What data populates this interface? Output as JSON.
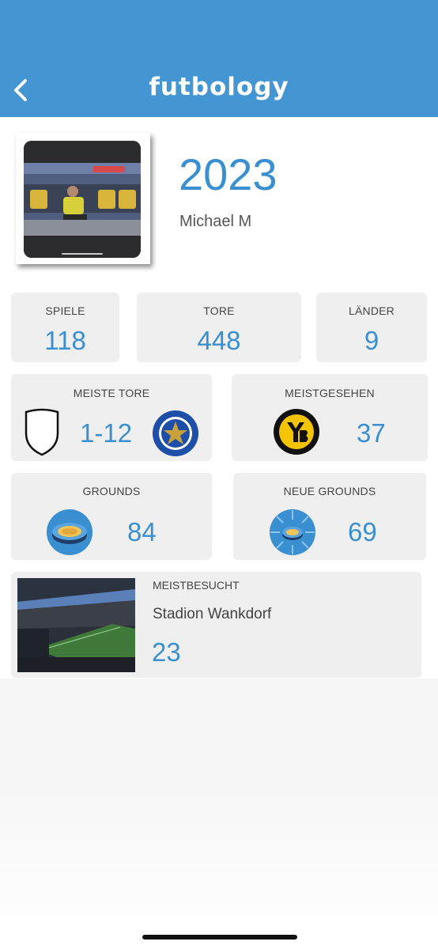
{
  "header": {
    "app_name": "futbology",
    "back_icon": "chevron-left-icon",
    "color": "#4496d2"
  },
  "profile": {
    "year": "2023",
    "name": "Michael M"
  },
  "stats": {
    "spiele": {
      "label": "SPIELE",
      "value": "118"
    },
    "tore": {
      "label": "TORE",
      "value": "448"
    },
    "laender": {
      "label": "LÄNDER",
      "value": "9"
    }
  },
  "meiste_tore": {
    "label": "MEISTE TORE",
    "score": "1-12",
    "home_icon": "blank-shield-icon",
    "away_icon": "fc-goldstern-crest-icon"
  },
  "meistgesehen": {
    "label": "MEISTGESEHEN",
    "value": "37",
    "icon": "bsc-young-boys-crest-icon"
  },
  "grounds": {
    "label": "GROUNDS",
    "value": "84",
    "icon": "stadium-icon"
  },
  "neue_grounds": {
    "label": "NEUE GROUNDS",
    "value": "69",
    "icon": "stadium-burst-icon"
  },
  "meistbesucht": {
    "label": "MEISTBESUCHT",
    "stadium": "Stadion Wankdorf",
    "value": "23"
  },
  "colors": {
    "accent": "#3a8fd0",
    "card": "#efefef",
    "yb_yellow": "#f5c400"
  }
}
